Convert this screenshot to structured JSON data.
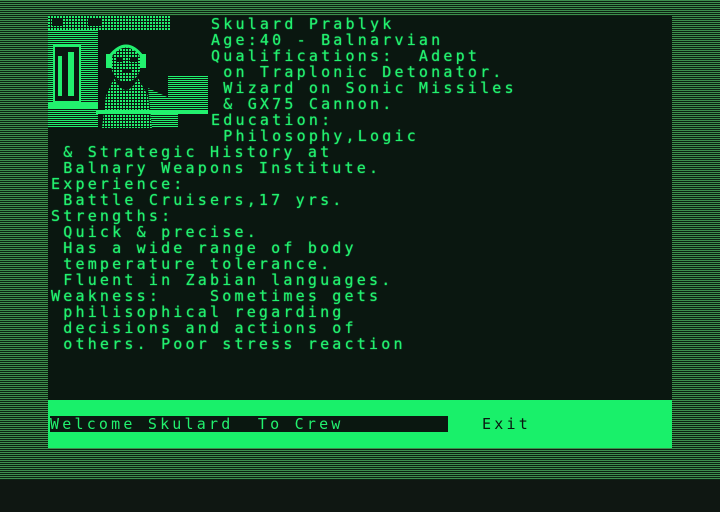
{
  "profile_lines": [
    "Skulard Prablyk",
    "Age:40 - Balnarvian",
    "Qualifications:  Adept",
    " on Traplonic Detonator.",
    " Wizard on Sonic Missiles",
    " & GX75 Cannon.",
    "Education:",
    " Philosophy,Logic",
    " & Strategic History at",
    " Balnary Weapons Institute.",
    "Experience:",
    " Battle Cruisers,17 yrs.",
    "Strengths:",
    " Quick & precise.",
    " Has a wide range of body",
    " temperature tolerance.",
    " Fluent in Zabian languages.",
    "Weakness:    Sometimes gets",
    " philisophical regarding",
    " decisions and actions of",
    " others. Poor stress reaction"
  ],
  "commands": {
    "welcome": "Welcome Skulard  To Crew",
    "exit": "Exit"
  },
  "colors": {
    "phosphor_green": "#22f06e",
    "screen_black": "#0a1710",
    "command_bar": "#19f06a"
  }
}
